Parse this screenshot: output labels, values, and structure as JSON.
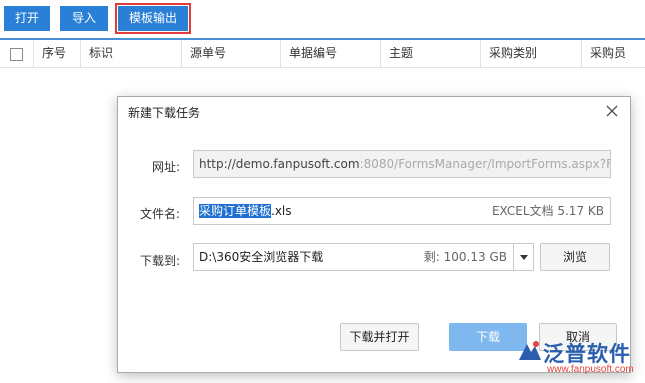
{
  "toolbar": {
    "open_label": "打开",
    "import_label": "导入",
    "export_template_label": "模板输出"
  },
  "table": {
    "columns": [
      "序号",
      "标识",
      "源单号",
      "单据编号",
      "主题",
      "采购类别",
      "采购员"
    ]
  },
  "dialog": {
    "title": "新建下载任务",
    "url_label": "网址:",
    "url_domain": "http://demo.fanpusoft.com",
    "url_rest": ":8080/FormsManager/ImportForms.aspx?Fo",
    "filename_label": "文件名:",
    "filename_selected": "采购订单模板",
    "filename_ext": ".xls",
    "file_type_size": "EXCEL文档 5.17 KB",
    "download_to_label": "下载到:",
    "download_path": "D:\\360安全浏览器下载",
    "free_space": "剩: 100.13 GB",
    "browse_label": "浏览",
    "download_open_label": "下载并打开",
    "download_label": "下载",
    "cancel_label": "取消"
  },
  "watermark": {
    "brand": "泛普软件",
    "url": "www.fanpusoft.com"
  },
  "colors": {
    "toolbar_button": "#2a7fd6",
    "active_outline": "#e23b3b",
    "primary_button": "#7fb7ef",
    "selection": "#1f6fd1"
  }
}
